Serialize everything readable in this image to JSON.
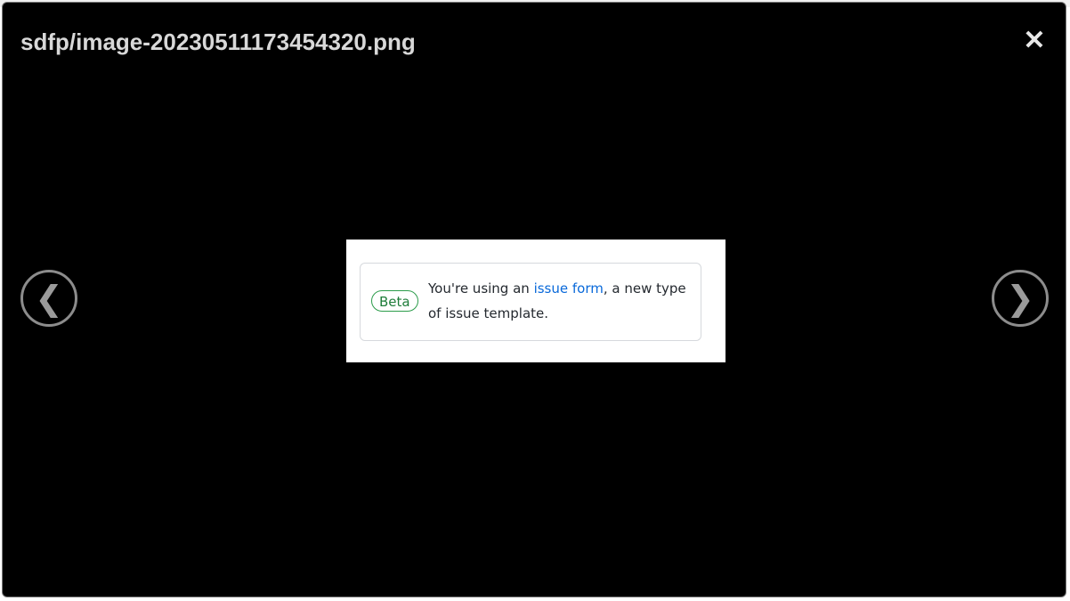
{
  "viewer": {
    "title": "sdfp/image-20230511173454320.png",
    "close_glyph": "✕",
    "prev_glyph": "❮",
    "next_glyph": "❯"
  },
  "image": {
    "badge": "Beta",
    "text_before": "You're using an ",
    "link_text": "issue form",
    "text_after": ", a new type of issue template."
  },
  "colors": {
    "overlay_bg": "#000000",
    "title_text": "#d8d8d8",
    "badge_green": "#2c9c4b",
    "link_blue": "#0969da"
  },
  "icons": [
    "close-icon",
    "chevron-left-icon",
    "chevron-right-icon"
  ]
}
